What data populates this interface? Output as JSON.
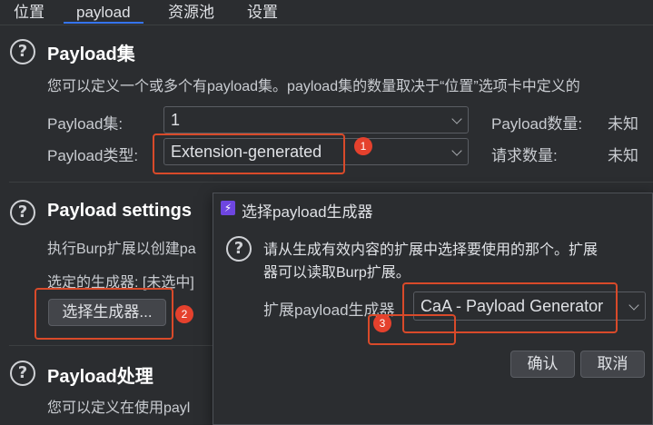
{
  "tabs": [
    {
      "label": "位置"
    },
    {
      "label": "payload"
    },
    {
      "label": "资源池"
    },
    {
      "label": "设置"
    }
  ],
  "payload_sets": {
    "title": "Payload集",
    "description": "您可以定义一个或多个有payload集。payload集的数量取决于“位置”选项卡中定义的",
    "set_label": "Payload集:",
    "set_value": "1",
    "type_label": "Payload类型:",
    "type_value": "Extension-generated",
    "count_label": "Payload数量:",
    "count_value": "未知",
    "request_label": "请求数量:",
    "request_value": "未知"
  },
  "payload_settings": {
    "title": "Payload settings",
    "description": "执行Burp扩展以创建pa",
    "selected_label": "选定的生成器: [未选中]",
    "select_button": "选择生成器..."
  },
  "payload_processing": {
    "title": "Payload处理",
    "description": "您可以定义在使用payl"
  },
  "help_icon_glyph": "?",
  "annotations": [
    "1",
    "2",
    "3"
  ],
  "dialog": {
    "title": "选择payload生成器",
    "logo_glyph": "⚡",
    "message_line1": "请从生成有效内容的扩展中选择要使用的那个。扩展",
    "message_line2": "器可以读取Burp扩展。",
    "generator_label": "扩展payload生成器",
    "generator_value": "CaA - Payload Generator",
    "ok_button": "确认",
    "cancel_button": "取消"
  },
  "colors": {
    "background": "#2b2d30",
    "active_tab_underline": "#3574f0",
    "annotation_red": "#e5412d",
    "dialog_logo": "#6e46e0"
  }
}
